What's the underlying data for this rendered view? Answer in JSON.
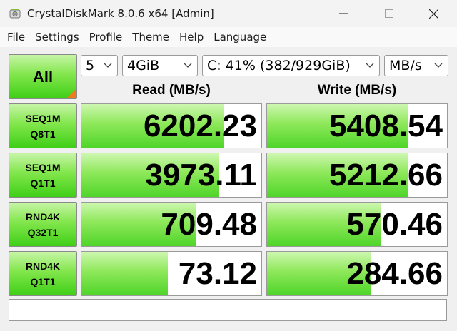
{
  "window": {
    "title": "CrystalDiskMark 8.0.6 x64 [Admin]"
  },
  "menu": [
    "File",
    "Settings",
    "Profile",
    "Theme",
    "Help",
    "Language"
  ],
  "controls": {
    "all_label": "All",
    "count": "5",
    "size": "4GiB",
    "drive": "C: 41% (382/929GiB)",
    "unit": "MB/s"
  },
  "headers": {
    "read": "Read (MB/s)",
    "write": "Write (MB/s)"
  },
  "rows": [
    {
      "line1": "SEQ1M",
      "line2": "Q8T1",
      "read": "6202.23",
      "write": "5408.54",
      "read_fill": 0.79,
      "write_fill": 0.78
    },
    {
      "line1": "SEQ1M",
      "line2": "Q1T1",
      "read": "3973.11",
      "write": "5212.66",
      "read_fill": 0.76,
      "write_fill": 0.78
    },
    {
      "line1": "RND4K",
      "line2": "Q32T1",
      "read": "709.48",
      "write": "570.46",
      "read_fill": 0.64,
      "write_fill": 0.63
    },
    {
      "line1": "RND4K",
      "line2": "Q1T1",
      "read": "73.12",
      "write": "284.66",
      "read_fill": 0.48,
      "write_fill": 0.58
    }
  ],
  "comment": ""
}
